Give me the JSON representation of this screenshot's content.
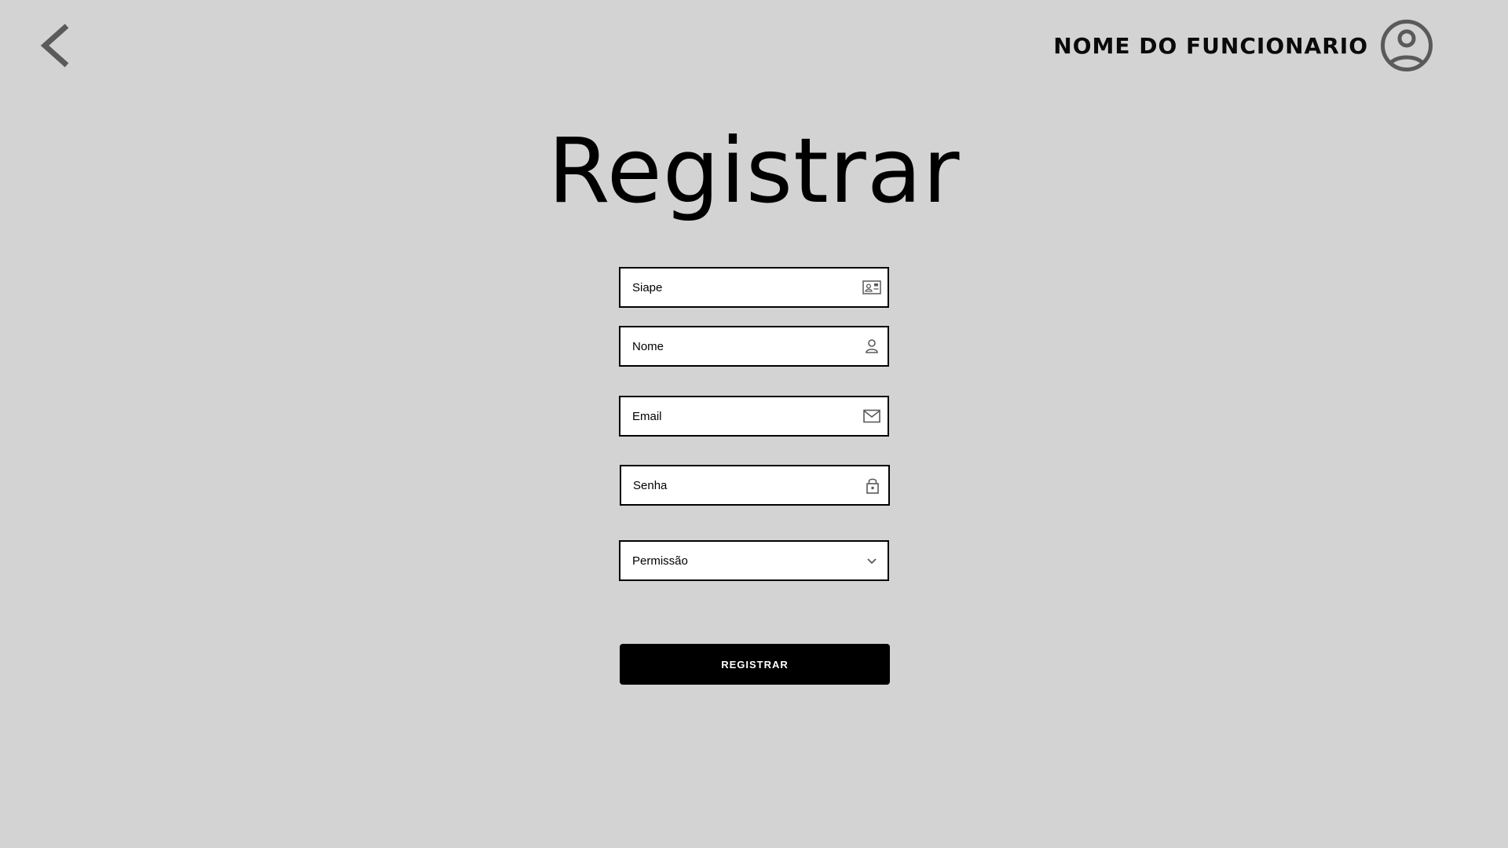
{
  "header": {
    "back_icon": "chevron-left-icon",
    "user_name": "NOME DO FUNCIONARIO",
    "avatar_icon": "user-circle-icon"
  },
  "page": {
    "title": "Registrar"
  },
  "form": {
    "siape": {
      "placeholder": "Siape",
      "value": "",
      "icon": "id-card-icon"
    },
    "nome": {
      "placeholder": "Nome",
      "value": "",
      "icon": "person-icon"
    },
    "email": {
      "placeholder": "Email",
      "value": "",
      "icon": "envelope-icon"
    },
    "senha": {
      "placeholder": "Senha",
      "value": "",
      "icon": "lock-icon"
    },
    "permissao": {
      "selected": "Permissão",
      "icon": "chevron-down-icon"
    },
    "submit_label": "REGISTRAR"
  },
  "colors": {
    "background": "#d3d3d3",
    "field_background": "#ffffff",
    "border": "#000000",
    "button": "#000000",
    "icon_gray": "#5a5a5a"
  }
}
